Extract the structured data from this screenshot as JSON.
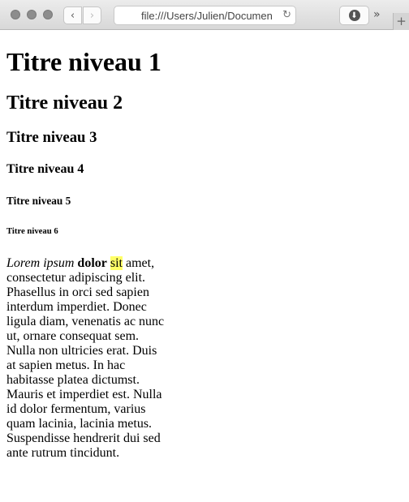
{
  "browser": {
    "url": "file:///Users/Julien/Documen",
    "back_icon": "‹",
    "forward_icon": "›",
    "reload_icon": "↻",
    "download_icon": "⬇",
    "overflow_icon": "»",
    "newtab_icon": "+"
  },
  "headings": {
    "h1": "Titre niveau 1",
    "h2": "Titre niveau 2",
    "h3": "Titre niveau 3",
    "h4": "Titre niveau 4",
    "h5": "Titre niveau 5",
    "h6": "Titre niveau 6"
  },
  "paragraph": {
    "emphasis": "Lorem ipsum",
    "strong": "dolor",
    "marked": "sit",
    "rest": "amet, consectetur adipiscing elit. Phasellus in orci sed sapien interdum imperdiet. Donec ligula diam, venenatis ac nunc ut, ornare consequat sem. Nulla non ultricies erat. Duis at sapien metus. In hac habitasse platea dictumst. Mauris et imperdiet est. Nulla id dolor fermentum, varius quam lacinia, lacinia metus. Suspendisse hendrerit dui sed ante rutrum tincidunt.",
    "highlight_color": "#ffff66"
  }
}
